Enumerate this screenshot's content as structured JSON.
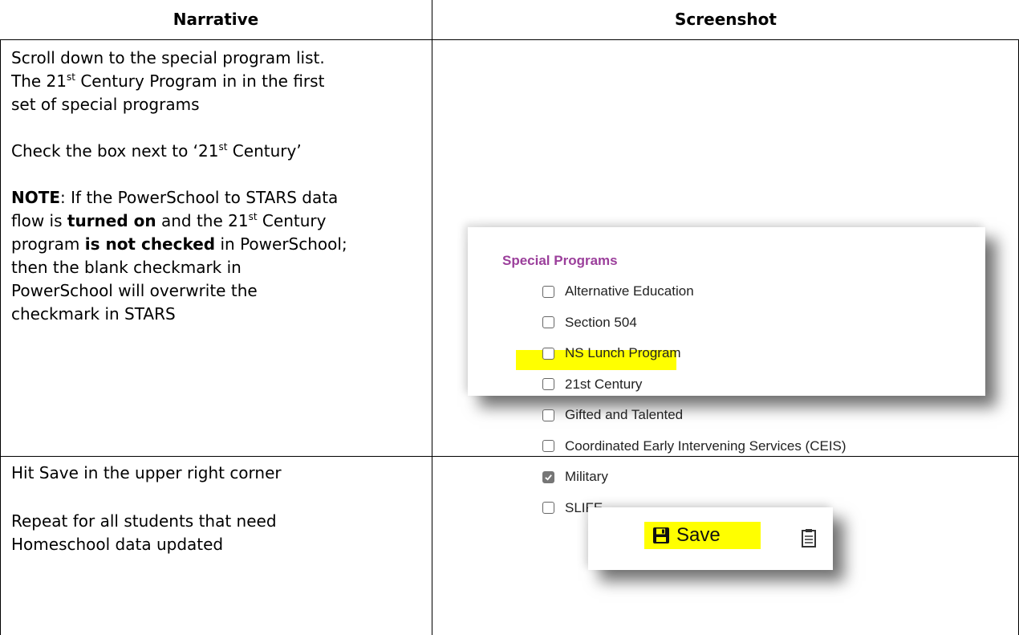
{
  "headers": {
    "narrative": "Narrative",
    "screenshot": "Screenshot"
  },
  "row1": {
    "line1": "Scroll down to the special program list.",
    "line2a": "The 21",
    "sup_st": "st",
    "line2b": " Century Program in in the first",
    "line3": "set of special programs",
    "check_a": "Check the box next to ‘21",
    "check_b": " Century’",
    "note_label": "NOTE",
    "note_1": ":  If the PowerSchool to STARS data",
    "note_2a": "flow is ",
    "note_turned_on": "turned on",
    "note_2b": " and the 21",
    "note_2c": " Century",
    "note_3a": "program ",
    "note_not_checked": "is not checked",
    "note_3b": " in PowerSchool;",
    "note_4": "then the blank checkmark in",
    "note_5": "PowerSchool will overwrite the",
    "note_6": "checkmark in STARS"
  },
  "row2": {
    "line1": "Hit Save in the upper right corner",
    "line2": "Repeat for all students that need",
    "line3": "Homeschool data updated"
  },
  "special_programs": {
    "title": "Special Programs",
    "items": [
      {
        "label": "Alternative Education",
        "checked": false
      },
      {
        "label": "Section 504",
        "checked": false
      },
      {
        "label": "NS Lunch Program",
        "checked": false
      },
      {
        "label": "21st Century",
        "checked": false,
        "highlighted": true
      },
      {
        "label": "Gifted and Talented",
        "checked": false
      },
      {
        "label": "Coordinated Early Intervening Services (CEIS)",
        "checked": false
      },
      {
        "label": "Military",
        "checked": true
      },
      {
        "label": "SLIFE",
        "checked": false
      }
    ]
  },
  "save": {
    "label": "Save",
    "icon": "floppy-disk-icon",
    "highlight_color": "#ffff00"
  },
  "colors": {
    "section_title": "#9b3f9b",
    "highlight": "#ffff00",
    "checkbox_checked": "#767676"
  }
}
